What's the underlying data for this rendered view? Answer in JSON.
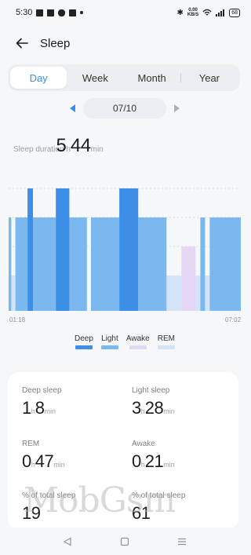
{
  "status_bar": {
    "time": "5:30",
    "net_speed_value": "0.00",
    "net_speed_unit": "KB/S",
    "battery": "68"
  },
  "header": {
    "title": "Sleep"
  },
  "tabs": [
    {
      "label": "Day",
      "active": true
    },
    {
      "label": "Week",
      "active": false
    },
    {
      "label": "Month",
      "active": false
    },
    {
      "label": "Year",
      "active": false
    }
  ],
  "date_nav": {
    "date": "07/10"
  },
  "summary": {
    "label": "Sleep duration",
    "hours": "5",
    "hours_unit": "h",
    "minutes": "44",
    "minutes_unit": "min"
  },
  "chart_data": {
    "type": "bar",
    "x_start": "01:18",
    "x_end": "07:02",
    "stages": [
      "Deep",
      "Light",
      "Awake",
      "REM"
    ],
    "segments": [
      {
        "stage": "Light",
        "start": "01:18",
        "end": "01:22"
      },
      {
        "stage": "REM",
        "start": "01:22",
        "end": "01:28"
      },
      {
        "stage": "Light",
        "start": "01:28",
        "end": "01:46"
      },
      {
        "stage": "Deep",
        "start": "01:46",
        "end": "01:54"
      },
      {
        "stage": "Light",
        "start": "01:54",
        "end": "02:28"
      },
      {
        "stage": "Deep",
        "start": "02:28",
        "end": "02:48"
      },
      {
        "stage": "Light",
        "start": "02:48",
        "end": "03:14"
      },
      {
        "stage": "Light",
        "start": "03:20",
        "end": "04:02"
      },
      {
        "stage": "Deep",
        "start": "04:02",
        "end": "04:30"
      },
      {
        "stage": "Light",
        "start": "04:30",
        "end": "05:12"
      },
      {
        "stage": "REM",
        "start": "05:12",
        "end": "05:34"
      },
      {
        "stage": "Awake",
        "start": "05:34",
        "end": "05:55"
      },
      {
        "stage": "REM",
        "start": "05:55",
        "end": "06:02"
      },
      {
        "stage": "Light",
        "start": "06:02",
        "end": "06:09"
      },
      {
        "stage": "REM",
        "start": "06:09",
        "end": "06:16"
      },
      {
        "stage": "Light",
        "start": "06:16",
        "end": "07:02"
      }
    ]
  },
  "legend": [
    {
      "label": "Deep",
      "color": "#3d8ee6"
    },
    {
      "label": "Light",
      "color": "#7cb8f0"
    },
    {
      "label": "Awake",
      "color": "#e5d6f4"
    },
    {
      "label": "REM",
      "color": "#d5e3f6"
    }
  ],
  "stats": {
    "deep": {
      "label": "Deep sleep",
      "hours": "1",
      "hours_unit": "h",
      "minutes": "8",
      "minutes_unit": "min"
    },
    "light": {
      "label": "Light sleep",
      "hours": "3",
      "hours_unit": "h",
      "minutes": "28",
      "minutes_unit": "min"
    },
    "rem": {
      "label": "REM",
      "hours": "0",
      "hours_unit": "h",
      "minutes": "47",
      "minutes_unit": "min"
    },
    "awake": {
      "label": "Awake",
      "hours": "0",
      "hours_unit": "h",
      "minutes": "21",
      "minutes_unit": "min"
    },
    "deep_pct": {
      "label": "% of total sleep",
      "value": "19"
    },
    "light_pct": {
      "label": "% of total sleep",
      "value": "61"
    }
  },
  "watermark": "MobGsm"
}
